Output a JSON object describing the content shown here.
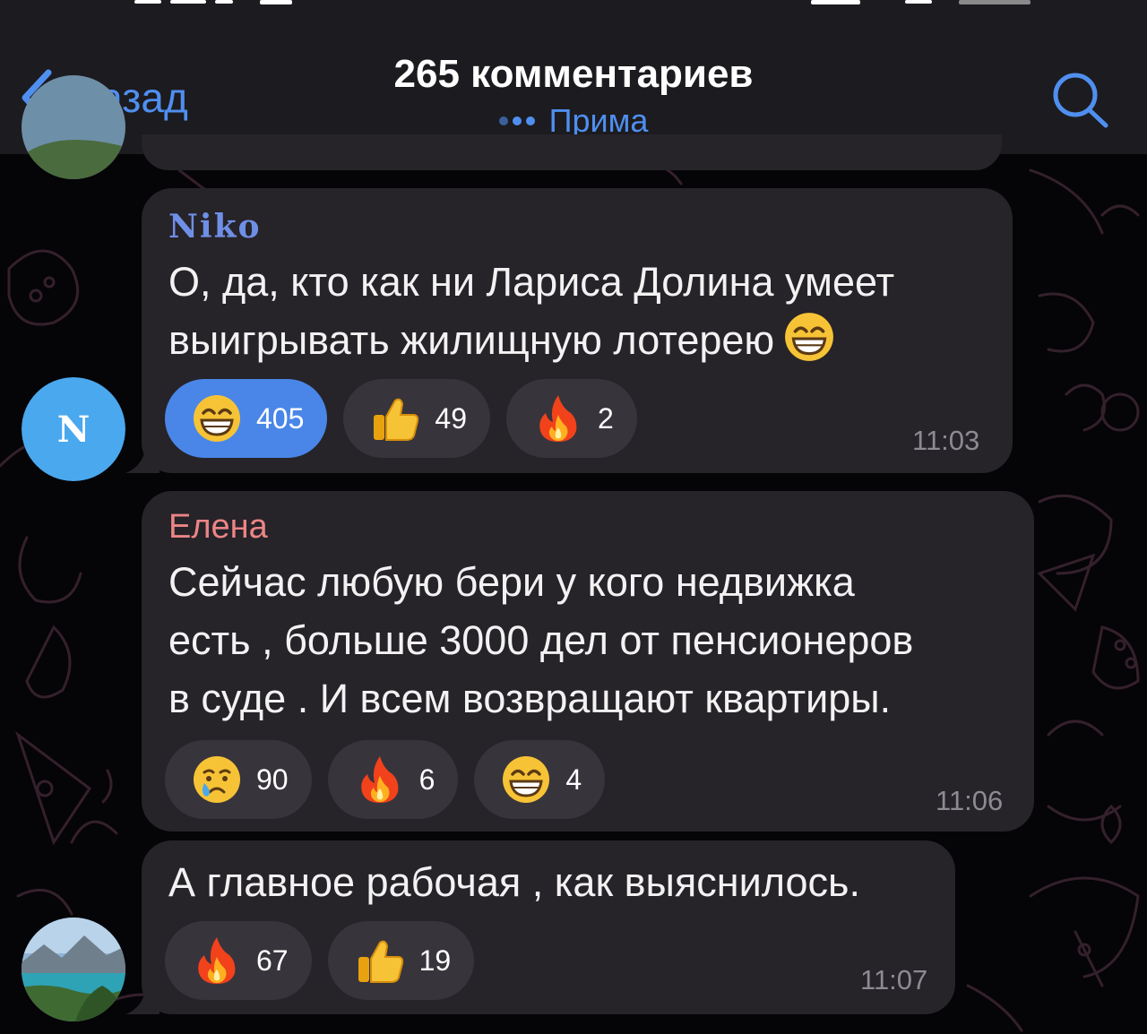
{
  "header": {
    "back_label": "Назад",
    "title": "265 комментариев",
    "subtitle": "Прима"
  },
  "messages": [
    {
      "sender": "Niko",
      "avatar_letter": "N",
      "text_lines": [
        "О, да, кто как ни Лариса Долина умеет",
        "выигрывать жилищную лотерею"
      ],
      "reactions": [
        {
          "emoji": "grinning-face",
          "count": "405",
          "active": true
        },
        {
          "emoji": "thumbs-up",
          "count": "49",
          "active": false
        },
        {
          "emoji": "fire",
          "count": "2",
          "active": false
        }
      ],
      "time": "11:03"
    },
    {
      "sender": "Елена",
      "text_lines": [
        "Сейчас любую бери у кого недвижка",
        "есть , больше 3000 дел от пенсионеров",
        "в суде . И всем возвращают квартиры."
      ],
      "reactions": [
        {
          "emoji": "crying-face",
          "count": "90",
          "active": false
        },
        {
          "emoji": "fire",
          "count": "6",
          "active": false
        },
        {
          "emoji": "grinning-face",
          "count": "4",
          "active": false
        }
      ],
      "time": "11:06"
    },
    {
      "sender": "",
      "text_lines": [
        "А главное рабочая , как выяснилось."
      ],
      "reactions": [
        {
          "emoji": "fire",
          "count": "67",
          "active": false
        },
        {
          "emoji": "thumbs-up",
          "count": "19",
          "active": false
        }
      ],
      "time": "11:07"
    }
  ],
  "colors": {
    "accent": "#4f8fef",
    "bubble": "#262329",
    "reaction_bg": "#38343c",
    "reaction_active": "#4a86e8",
    "header_bg": "#1c1b1f",
    "elena_name": "#ec8585",
    "niko_avatar": "#4aa8ee"
  }
}
